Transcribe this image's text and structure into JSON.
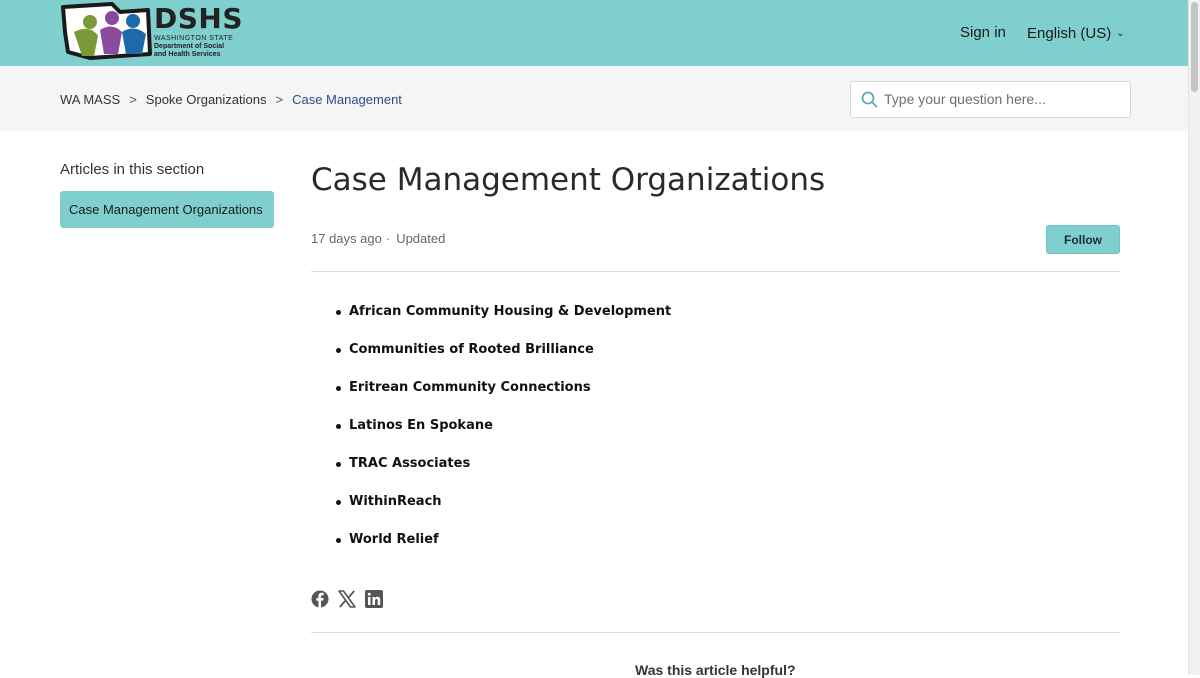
{
  "header": {
    "logo": {
      "title": "DSHS",
      "line1": "WASHINGTON STATE",
      "line2": "Department of Social",
      "line3": "and Health Services"
    },
    "sign_in": "Sign in",
    "language": "English (US)"
  },
  "breadcrumb": {
    "items": [
      "WA MASS",
      "Spoke Organizations",
      "Case Management"
    ],
    "separator": ">"
  },
  "search": {
    "placeholder": "Type your question here..."
  },
  "sidebar": {
    "heading": "Articles in this section",
    "items": [
      "Case Management Organizations"
    ]
  },
  "article": {
    "title": "Case Management Organizations",
    "age": "17 days ago",
    "meta_separator": "·",
    "updated": "Updated",
    "follow_label": "Follow",
    "organizations": [
      "African Community Housing & Development",
      "Communities of Rooted Brilliance",
      "Eritrean Community Connections",
      "Latinos En Spokane",
      "TRAC Associates",
      "WithinReach",
      "World Relief"
    ],
    "helpful_prompt": "Was this article helpful?"
  },
  "share_icons": [
    "facebook-icon",
    "x-icon",
    "linkedin-icon"
  ],
  "colors": {
    "accent": "#7fcfcf",
    "subbar_bg": "#f5f5f5",
    "breadcrumb_current": "#2c4e85",
    "text": "#333333"
  }
}
